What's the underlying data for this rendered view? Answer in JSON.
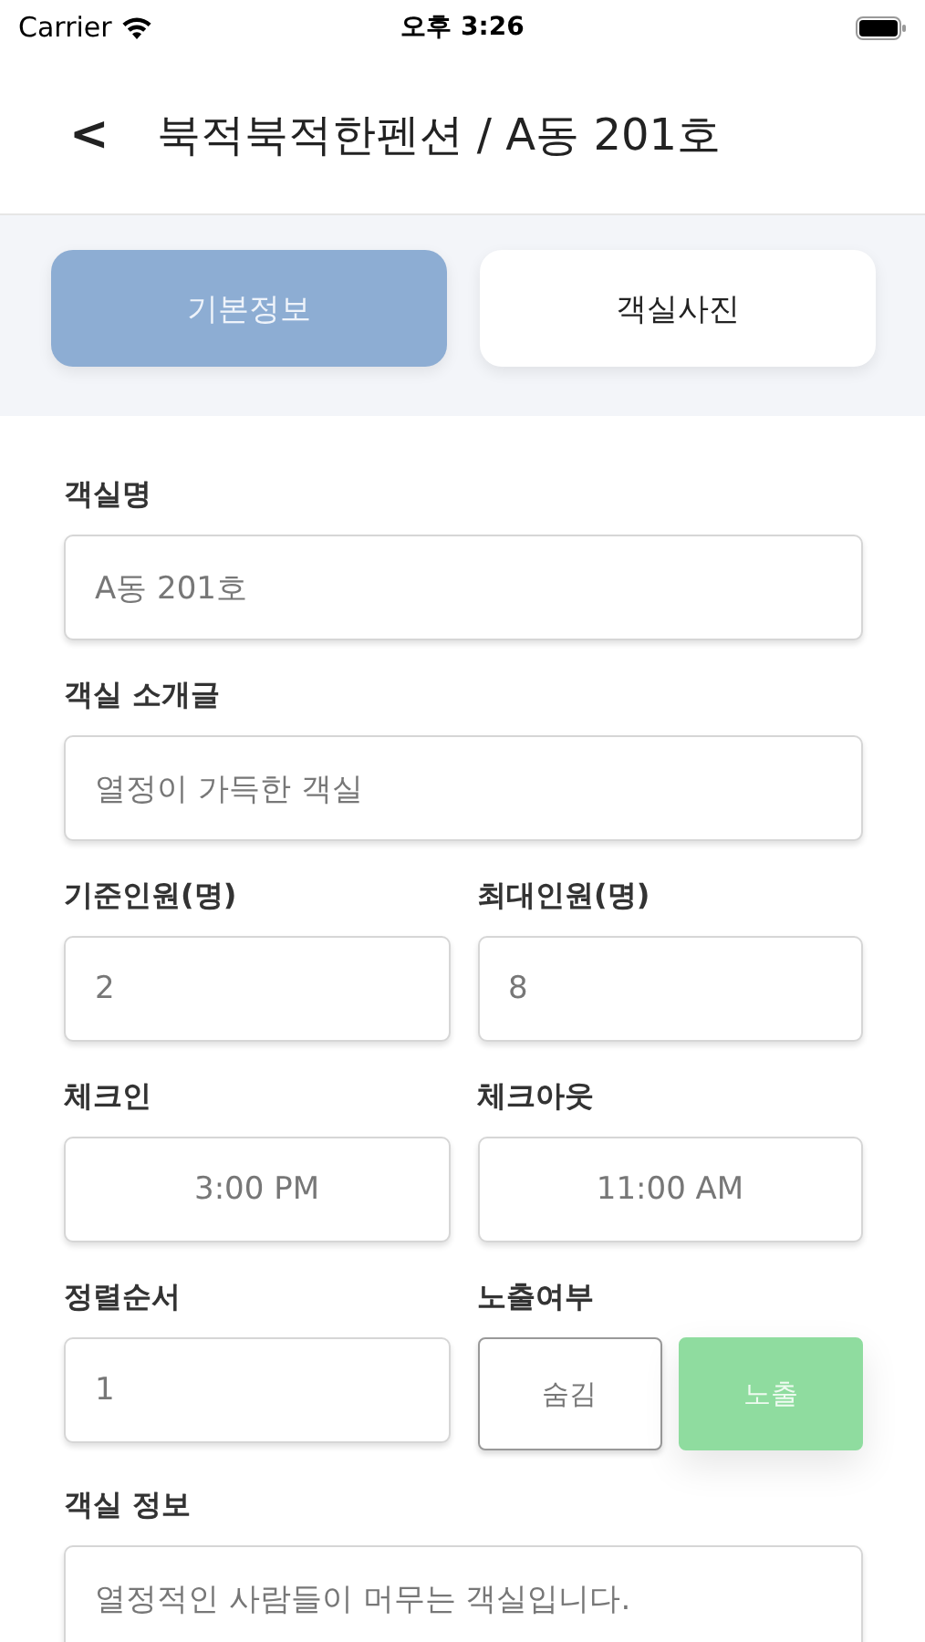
{
  "status_bar": {
    "carrier": "Carrier",
    "time": "오후 3:26"
  },
  "header": {
    "back": "<",
    "title": "북적북적한펜션 / A동 201호"
  },
  "tabs": [
    {
      "label": "기본정보",
      "selected": true
    },
    {
      "label": "객실사진",
      "selected": false
    }
  ],
  "rows": [
    {
      "fields": [
        {
          "kind": "text",
          "label": "객실명",
          "value": "A동 201호"
        }
      ]
    },
    {
      "fields": [
        {
          "kind": "text",
          "label": "객실 소개글",
          "value": "열정이 가득한 객실"
        }
      ]
    },
    {
      "fields": [
        {
          "kind": "text",
          "label": "기준인원(명)",
          "value": "2"
        },
        {
          "kind": "text",
          "label": "최대인원(명)",
          "value": "8"
        }
      ]
    },
    {
      "fields": [
        {
          "kind": "time",
          "label": "체크인",
          "value": "3:00 PM"
        },
        {
          "kind": "time",
          "label": "체크아웃",
          "value": "11:00 AM"
        }
      ]
    },
    {
      "fields": [
        {
          "kind": "text",
          "label": "정렬순서",
          "value": "1"
        },
        {
          "kind": "toggle",
          "label": "노출여부",
          "options": [
            {
              "label": "숨김",
              "selected": false
            },
            {
              "label": "노출",
              "selected": true
            }
          ]
        }
      ]
    },
    {
      "fields": [
        {
          "kind": "text",
          "label": "객실 정보",
          "value": "열정적인 사람들이 머무는 객실입니다."
        }
      ]
    }
  ]
}
